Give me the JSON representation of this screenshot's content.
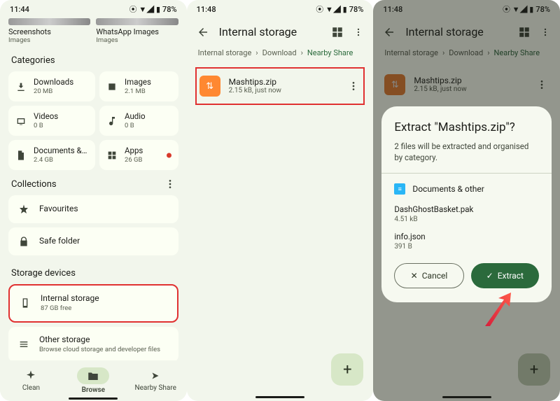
{
  "status": {
    "time1": "11:44",
    "time2": "11:48",
    "time3": "11:48",
    "battery": "78%"
  },
  "panel1": {
    "recent": [
      {
        "title": "Screenshots",
        "sub": "Images"
      },
      {
        "title": "WhatsApp Images",
        "sub": "Images"
      }
    ],
    "categoriesTitle": "Categories",
    "categories": [
      {
        "name": "Downloads",
        "size": "20 MB"
      },
      {
        "name": "Images",
        "size": "2.1 MB"
      },
      {
        "name": "Videos",
        "size": "0 B"
      },
      {
        "name": "Audio",
        "size": "0 B"
      },
      {
        "name": "Documents & other",
        "size": "2.4 GB"
      },
      {
        "name": "Apps",
        "size": "26 GB",
        "hasNew": true
      }
    ],
    "collectionsTitle": "Collections",
    "collections": [
      {
        "title": "Favourites"
      },
      {
        "title": "Safe folder"
      }
    ],
    "storageTitle": "Storage devices",
    "storage": [
      {
        "title": "Internal storage",
        "sub": "87 GB free",
        "highlight": true
      },
      {
        "title": "Other storage",
        "sub": "Browse cloud storage and developer files"
      }
    ],
    "nav": {
      "clean": "Clean",
      "browse": "Browse",
      "share": "Nearby Share"
    }
  },
  "panel2": {
    "title": "Internal storage",
    "crumbs": [
      "Internal storage",
      "Download",
      "Nearby Share"
    ],
    "file": {
      "name": "Mashtips.zip",
      "sub": "2.15 kB, just now"
    }
  },
  "panel3": {
    "title": "Internal storage",
    "crumbs": [
      "Internal storage",
      "Download",
      "Nearby Share"
    ],
    "file": {
      "name": "Mashtips.zip",
      "sub": "2.15 kB, just now"
    },
    "dialog": {
      "title": "Extract \"Mashtips.zip\"?",
      "msg": "2 files will be extracted and organised by category.",
      "groupLabel": "Documents & other",
      "items": [
        {
          "name": "DashGhostBasket.pak",
          "size": "4.51 kB"
        },
        {
          "name": "info.json",
          "size": "391 B"
        }
      ],
      "cancel": "Cancel",
      "extract": "Extract"
    }
  }
}
